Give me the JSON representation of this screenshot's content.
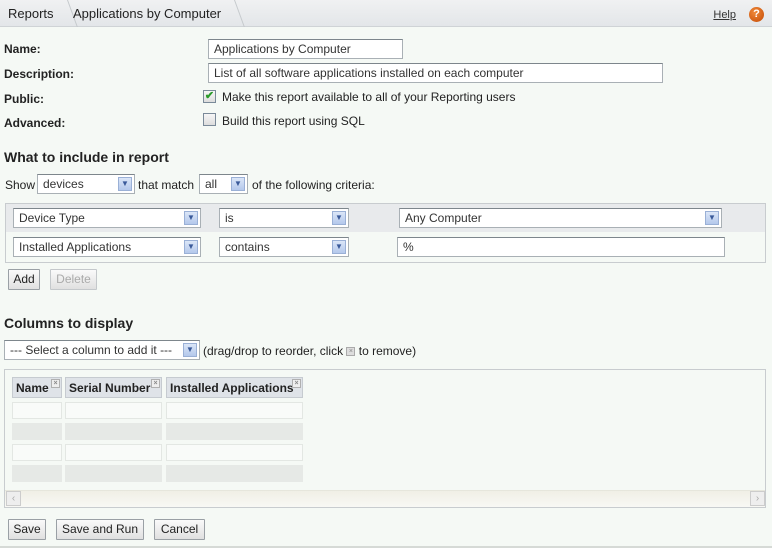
{
  "breadcrumb": [
    "Reports",
    "Applications by Computer"
  ],
  "help": {
    "label": "Help",
    "icon": "question-icon"
  },
  "form": {
    "name_label": "Name:",
    "name_value": "Applications by Computer",
    "description_label": "Description:",
    "description_value": "List of all software applications installed on each computer",
    "public_label": "Public:",
    "public_text": "Make this report available to all of your Reporting users",
    "public_checked": true,
    "advanced_label": "Advanced:",
    "advanced_text": "Build this report using SQL",
    "advanced_checked": false
  },
  "include": {
    "heading": "What to include in report",
    "show_label": "Show",
    "show_value": "devices",
    "match_label": "that match",
    "match_value": "all",
    "criteria_label": "of the following criteria:",
    "criteria": [
      {
        "field": "Device Type",
        "operator": "is",
        "value": "Any Computer"
      },
      {
        "field": "Installed Applications",
        "operator": "contains",
        "value": "%"
      }
    ],
    "add_label": "Add",
    "delete_label": "Delete"
  },
  "columns": {
    "heading": "Columns to display",
    "select_placeholder": "--- Select a column to add it ---",
    "hint_before": "(drag/drop to reorder, click",
    "hint_after": "to remove)",
    "headers": [
      "Name",
      "Serial Number",
      "Installed Applications"
    ]
  },
  "actions": {
    "save": "Save",
    "save_run": "Save and Run",
    "cancel": "Cancel"
  }
}
